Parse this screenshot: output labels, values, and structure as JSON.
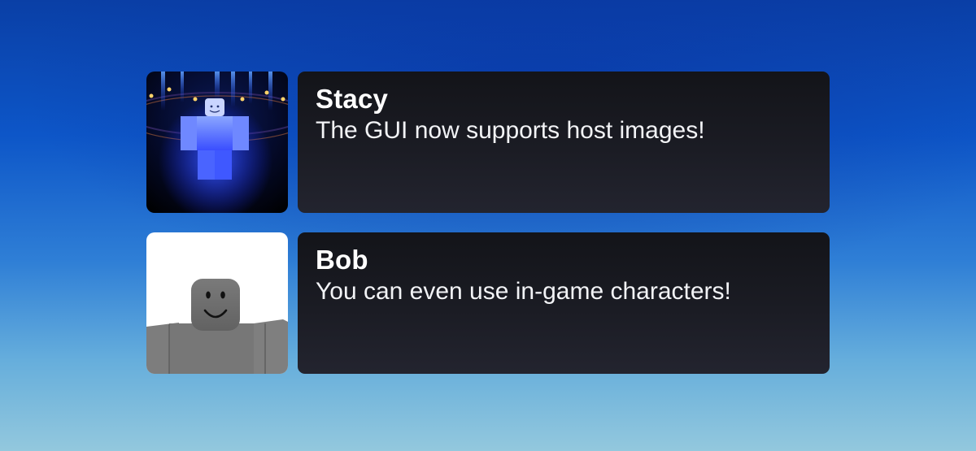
{
  "messages": [
    {
      "sender": "Stacy",
      "text": "The GUI now supports host images!",
      "avatar_icon": "glowing-blue-character-on-stage-avatar"
    },
    {
      "sender": "Bob",
      "text": "You can even use in-game characters!",
      "avatar_icon": "gray-smiling-character-avatar"
    }
  ],
  "colors": {
    "bubble_top": "#131419",
    "bubble_bottom": "#23242f",
    "sky_top": "#0a3fa6",
    "sky_bottom": "#93c8dd",
    "text": "#ffffff"
  }
}
